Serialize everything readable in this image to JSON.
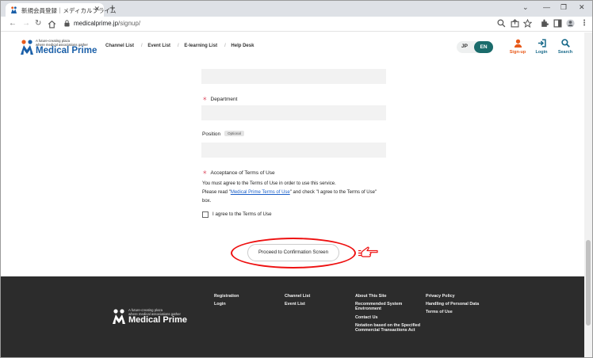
{
  "browser": {
    "tab_title": "新規会員登録｜メディカルプライム",
    "url_host": "medicalprime.jp",
    "url_path": "/signup/"
  },
  "header": {
    "logo_tagline_1": "A future-creating plaza",
    "logo_tagline_2": "where medical associations gather",
    "logo_name": "Medical Prime",
    "nav": [
      "Channel List",
      "Event List",
      "E-learning List",
      "Help Desk"
    ],
    "lang_jp": "JP",
    "lang_en": "EN",
    "signup_label": "Sign-up",
    "login_label": "Login",
    "search_label": "Search"
  },
  "form": {
    "department_label": "Department",
    "position_label": "Position",
    "optional_badge": "Optional",
    "terms_label": "Acceptance of Terms of Use",
    "terms_line1": "You must agree to the Terms of Use in order to use this service.",
    "terms_line2_pre": "Please read \"",
    "terms_link": "Medical Prime Terms of Use",
    "terms_line2_post": "\" and check \"I agree to the Terms of Use\"",
    "terms_line3": "box.",
    "agree_label": "I agree to the Terms of Use",
    "proceed_label": "Proceed to Confirmation Screen"
  },
  "footer": {
    "logo_tagline_1": "A future-creating plaza",
    "logo_tagline_2": "where medical associations gather",
    "logo_name": "Medical Prime",
    "col1": [
      "Registration",
      "Login"
    ],
    "col2": [
      "Channel List",
      "Event List"
    ],
    "col3": [
      "About This Site",
      "Recommended System Environment",
      "Contact Us",
      "Notation based on the Specified Commercial Transactions Act"
    ],
    "col4": [
      "Privacy Policy",
      "Handling of Personal Data",
      "Terms of Use"
    ]
  },
  "colors": {
    "brand_blue": "#1a5fa8",
    "accent_orange": "#e85a1a",
    "accent_teal": "#1a6b6b",
    "highlight_red": "#e11111"
  }
}
